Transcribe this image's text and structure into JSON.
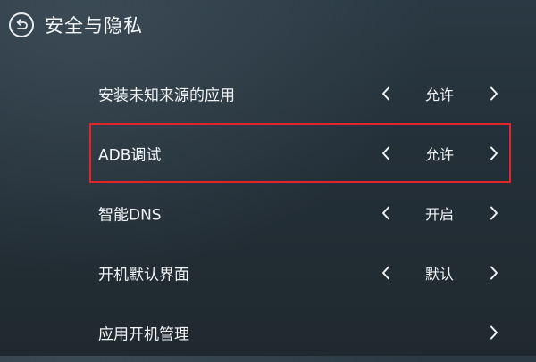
{
  "header": {
    "title": "安全与隐私",
    "back_icon": "back-arrow-circle-icon"
  },
  "settings": [
    {
      "label": "安装未知来源的应用",
      "value": "允许",
      "has_left_arrow": true,
      "has_right_arrow": true,
      "selected": false
    },
    {
      "label": "ADB调试",
      "value": "允许",
      "has_left_arrow": true,
      "has_right_arrow": true,
      "selected": true
    },
    {
      "label": "智能DNS",
      "value": "开启",
      "has_left_arrow": true,
      "has_right_arrow": true,
      "selected": false
    },
    {
      "label": "开机默认界面",
      "value": "默认",
      "has_left_arrow": true,
      "has_right_arrow": true,
      "selected": false
    },
    {
      "label": "应用开机管理",
      "value": "",
      "has_left_arrow": false,
      "has_right_arrow": true,
      "selected": false
    }
  ],
  "colors": {
    "selection_border": "#e0262b",
    "text": "#f2f4f5",
    "background_top": "#2a3943",
    "background_bottom": "#1f292f"
  }
}
